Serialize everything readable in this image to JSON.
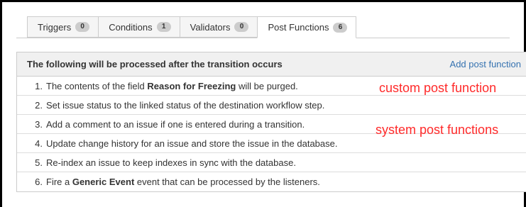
{
  "tabs": [
    {
      "label": "Triggers",
      "count": "0",
      "active": false
    },
    {
      "label": "Conditions",
      "count": "1",
      "active": false
    },
    {
      "label": "Validators",
      "count": "0",
      "active": false
    },
    {
      "label": "Post Functions",
      "count": "6",
      "active": true
    }
  ],
  "panel": {
    "title": "The following will be processed after the transition occurs",
    "add_link": "Add post function",
    "rows": [
      {
        "num": "1.",
        "pre": "The contents of the field ",
        "bold": "Reason for Freezing",
        "post": " will be purged."
      },
      {
        "num": "2.",
        "pre": "Set issue status to the linked status of the destination workflow step.",
        "bold": "",
        "post": ""
      },
      {
        "num": "3.",
        "pre": "Add a comment to an issue if one is entered during a transition.",
        "bold": "",
        "post": ""
      },
      {
        "num": "4.",
        "pre": "Update change history for an issue and store the issue in the database.",
        "bold": "",
        "post": ""
      },
      {
        "num": "5.",
        "pre": "Re-index an issue to keep indexes in sync with the database.",
        "bold": "",
        "post": ""
      },
      {
        "num": "6.",
        "pre": "Fire a ",
        "bold": "Generic Event",
        "post": " event that can be processed by the listeners."
      }
    ]
  },
  "annotations": {
    "custom": "custom post function",
    "system": "system post functions"
  },
  "colors": {
    "link": "#3572b0",
    "annotation": "#ff2a2a",
    "badge": "#cccccc",
    "header_bg": "#f0f0f0"
  }
}
